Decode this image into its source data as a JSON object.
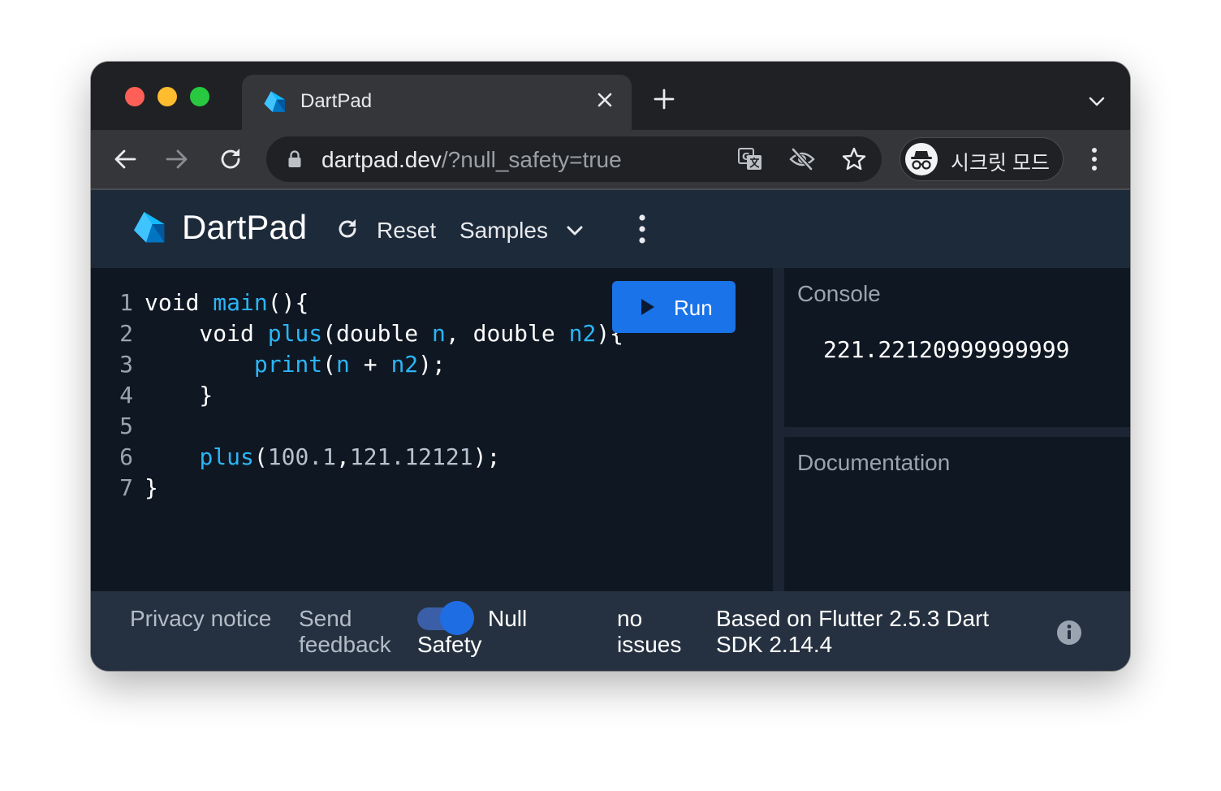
{
  "browser": {
    "tab": {
      "title": "DartPad",
      "favicon": "dart-logo-icon"
    },
    "address": {
      "host": "dartpad.dev",
      "path": "/?null_safety=true"
    },
    "profile": {
      "label": "시크릿 모드",
      "icon": "incognito-icon"
    }
  },
  "app": {
    "title": "DartPad",
    "reset_label": "Reset",
    "samples_label": "Samples"
  },
  "editor": {
    "run_label": "Run",
    "lines": [
      {
        "n": "1",
        "parts": [
          [
            "plain",
            "void "
          ],
          [
            "fn",
            "main"
          ],
          [
            "plain",
            "(){"
          ]
        ]
      },
      {
        "n": "2",
        "parts": [
          [
            "plain",
            "    void "
          ],
          [
            "fn",
            "plus"
          ],
          [
            "plain",
            "(double "
          ],
          [
            "fn",
            "n"
          ],
          [
            "plain",
            ", double "
          ],
          [
            "fn",
            "n2"
          ],
          [
            "plain",
            "){"
          ]
        ]
      },
      {
        "n": "3",
        "parts": [
          [
            "plain",
            "        "
          ],
          [
            "fn",
            "print"
          ],
          [
            "plain",
            "("
          ],
          [
            "fn",
            "n"
          ],
          [
            "plain",
            " + "
          ],
          [
            "fn",
            "n2"
          ],
          [
            "plain",
            ");"
          ]
        ]
      },
      {
        "n": "4",
        "parts": [
          [
            "plain",
            "    }"
          ]
        ]
      },
      {
        "n": "5",
        "parts": [
          [
            "plain",
            ""
          ]
        ]
      },
      {
        "n": "6",
        "parts": [
          [
            "plain",
            "    "
          ],
          [
            "fn",
            "plus"
          ],
          [
            "plain",
            "("
          ],
          [
            "num",
            "100.1"
          ],
          [
            "plain",
            ","
          ],
          [
            "num",
            "121.12121"
          ],
          [
            "plain",
            ");"
          ]
        ]
      },
      {
        "n": "7",
        "parts": [
          [
            "plain",
            "}"
          ]
        ]
      }
    ]
  },
  "console": {
    "title": "Console",
    "output": "221.22120999999999"
  },
  "docs": {
    "title": "Documentation"
  },
  "footer": {
    "privacy": "Privacy notice",
    "feedback": "Send feedback",
    "null_safety_line1": "Null",
    "null_safety_line2": "Safety",
    "null_safety_enabled": true,
    "issues": "no issues",
    "version": "Based on Flutter 2.5.3 Dart SDK 2.14.4"
  },
  "colors": {
    "accent": "#1a73e8",
    "editor_bg": "#0f1722",
    "appbar_bg": "#1d2a3a",
    "code_function": "#2bb5f5"
  }
}
